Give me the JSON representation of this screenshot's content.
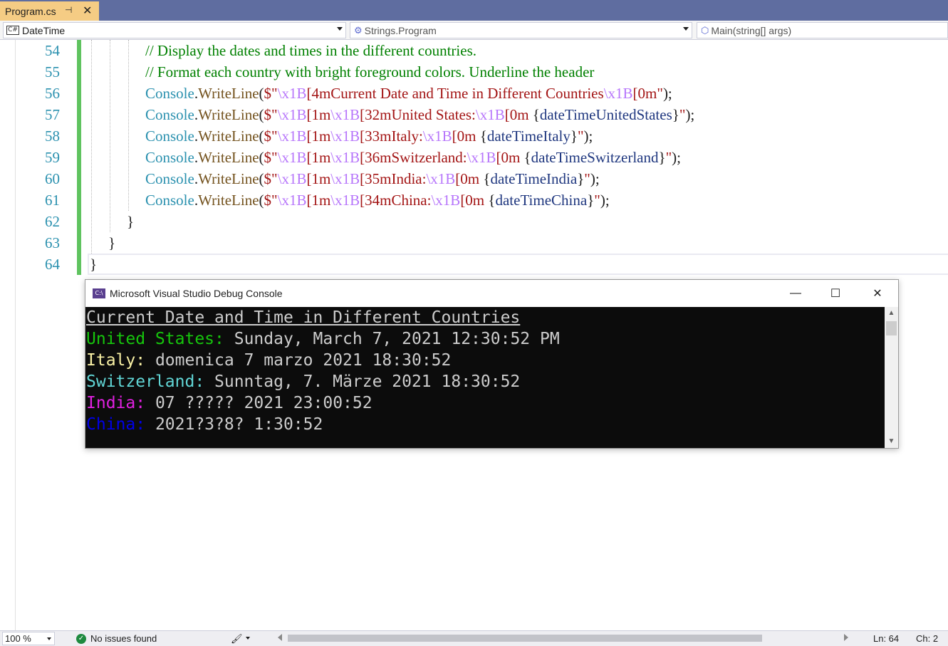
{
  "tab": {
    "title": "Program.cs",
    "pin": "⊣",
    "close": "✕"
  },
  "navbar": {
    "project_badge": "C#",
    "project": "DateTime",
    "type": "Strings.Program",
    "member": "Main(string[] args)"
  },
  "editor": {
    "line_numbers": [
      "54",
      "55",
      "56",
      "57",
      "58",
      "59",
      "60",
      "61",
      "62",
      "63",
      "64"
    ],
    "lines": [
      [
        {
          "t": "// Display the dates and times in the different countries.",
          "c": "com"
        }
      ],
      [
        {
          "t": "// Format each country with bright foreground colors. Underline the header",
          "c": "com"
        }
      ],
      [
        {
          "t": "Console",
          "c": "cls"
        },
        {
          "t": ".",
          "c": "punc"
        },
        {
          "t": "WriteLine",
          "c": "meth"
        },
        {
          "t": "(",
          "c": "punc"
        },
        {
          "t": "$\"",
          "c": "str"
        },
        {
          "t": "\\x1B",
          "c": "esc"
        },
        {
          "t": "[4mCurrent Date and Time in Different Countries",
          "c": "str"
        },
        {
          "t": "\\x1B",
          "c": "esc"
        },
        {
          "t": "[0m\"",
          "c": "str"
        },
        {
          "t": ");",
          "c": "punc"
        }
      ],
      [
        {
          "t": "Console",
          "c": "cls"
        },
        {
          "t": ".",
          "c": "punc"
        },
        {
          "t": "WriteLine",
          "c": "meth"
        },
        {
          "t": "(",
          "c": "punc"
        },
        {
          "t": "$\"",
          "c": "str"
        },
        {
          "t": "\\x1B",
          "c": "esc"
        },
        {
          "t": "[1m",
          "c": "str"
        },
        {
          "t": "\\x1B",
          "c": "esc"
        },
        {
          "t": "[32mUnited States:",
          "c": "str"
        },
        {
          "t": "\\x1B",
          "c": "esc"
        },
        {
          "t": "[0m ",
          "c": "str"
        },
        {
          "t": "{",
          "c": "punc"
        },
        {
          "t": "dateTimeUnitedStates",
          "c": "id"
        },
        {
          "t": "}",
          "c": "punc"
        },
        {
          "t": "\"",
          "c": "str"
        },
        {
          "t": ");",
          "c": "punc"
        }
      ],
      [
        {
          "t": "Console",
          "c": "cls"
        },
        {
          "t": ".",
          "c": "punc"
        },
        {
          "t": "WriteLine",
          "c": "meth"
        },
        {
          "t": "(",
          "c": "punc"
        },
        {
          "t": "$\"",
          "c": "str"
        },
        {
          "t": "\\x1B",
          "c": "esc"
        },
        {
          "t": "[1m",
          "c": "str"
        },
        {
          "t": "\\x1B",
          "c": "esc"
        },
        {
          "t": "[33mItaly:",
          "c": "str"
        },
        {
          "t": "\\x1B",
          "c": "esc"
        },
        {
          "t": "[0m ",
          "c": "str"
        },
        {
          "t": "{",
          "c": "punc"
        },
        {
          "t": "dateTimeItaly",
          "c": "id"
        },
        {
          "t": "}",
          "c": "punc"
        },
        {
          "t": "\"",
          "c": "str"
        },
        {
          "t": ");",
          "c": "punc"
        }
      ],
      [
        {
          "t": "Console",
          "c": "cls"
        },
        {
          "t": ".",
          "c": "punc"
        },
        {
          "t": "WriteLine",
          "c": "meth"
        },
        {
          "t": "(",
          "c": "punc"
        },
        {
          "t": "$\"",
          "c": "str"
        },
        {
          "t": "\\x1B",
          "c": "esc"
        },
        {
          "t": "[1m",
          "c": "str"
        },
        {
          "t": "\\x1B",
          "c": "esc"
        },
        {
          "t": "[36mSwitzerland:",
          "c": "str"
        },
        {
          "t": "\\x1B",
          "c": "esc"
        },
        {
          "t": "[0m ",
          "c": "str"
        },
        {
          "t": "{",
          "c": "punc"
        },
        {
          "t": "dateTimeSwitzerland",
          "c": "id"
        },
        {
          "t": "}",
          "c": "punc"
        },
        {
          "t": "\"",
          "c": "str"
        },
        {
          "t": ");",
          "c": "punc"
        }
      ],
      [
        {
          "t": "Console",
          "c": "cls"
        },
        {
          "t": ".",
          "c": "punc"
        },
        {
          "t": "WriteLine",
          "c": "meth"
        },
        {
          "t": "(",
          "c": "punc"
        },
        {
          "t": "$\"",
          "c": "str"
        },
        {
          "t": "\\x1B",
          "c": "esc"
        },
        {
          "t": "[1m",
          "c": "str"
        },
        {
          "t": "\\x1B",
          "c": "esc"
        },
        {
          "t": "[35mIndia:",
          "c": "str"
        },
        {
          "t": "\\x1B",
          "c": "esc"
        },
        {
          "t": "[0m ",
          "c": "str"
        },
        {
          "t": "{",
          "c": "punc"
        },
        {
          "t": "dateTimeIndia",
          "c": "id"
        },
        {
          "t": "}",
          "c": "punc"
        },
        {
          "t": "\"",
          "c": "str"
        },
        {
          "t": ");",
          "c": "punc"
        }
      ],
      [
        {
          "t": "Console",
          "c": "cls"
        },
        {
          "t": ".",
          "c": "punc"
        },
        {
          "t": "WriteLine",
          "c": "meth"
        },
        {
          "t": "(",
          "c": "punc"
        },
        {
          "t": "$\"",
          "c": "str"
        },
        {
          "t": "\\x1B",
          "c": "esc"
        },
        {
          "t": "[1m",
          "c": "str"
        },
        {
          "t": "\\x1B",
          "c": "esc"
        },
        {
          "t": "[34mChina:",
          "c": "str"
        },
        {
          "t": "\\x1B",
          "c": "esc"
        },
        {
          "t": "[0m ",
          "c": "str"
        },
        {
          "t": "{",
          "c": "punc"
        },
        {
          "t": "dateTimeChina",
          "c": "id"
        },
        {
          "t": "}",
          "c": "punc"
        },
        {
          "t": "\"",
          "c": "str"
        },
        {
          "t": ");",
          "c": "punc"
        }
      ],
      [
        {
          "t": "}",
          "c": "punc"
        }
      ],
      [
        {
          "t": "}",
          "c": "punc"
        }
      ],
      [
        {
          "t": "}",
          "c": "punc"
        }
      ]
    ]
  },
  "console": {
    "title": "Microsoft Visual Studio Debug Console",
    "icon_label": "C:\\",
    "buttons": {
      "minimize": "—",
      "maximize": "☐",
      "close": "✕"
    },
    "header": "Current Date and Time in Different Countries",
    "rows": [
      {
        "label": "United States:",
        "value": " Sunday, March 7, 2021 12:30:52 PM",
        "color": "#16c60c"
      },
      {
        "label": "Italy:",
        "value": " domenica 7 marzo 2021 18:30:52",
        "color": "#f9f1a5"
      },
      {
        "label": "Switzerland:",
        "value": " Sunntag, 7. Märze 2021 18:30:52",
        "color": "#61d6d6"
      },
      {
        "label": "India:",
        "value": " 07 ????? 2021 23:00:52",
        "color": "#e020e0"
      },
      {
        "label": "China:",
        "value": " 2021?3?8? 1:30:52",
        "color": "#0000e8"
      }
    ],
    "text_color": "#cccccc"
  },
  "statusbar": {
    "zoom": "100 %",
    "issues": "No issues found",
    "line": "Ln: 64",
    "col": "Ch: 2"
  },
  "colors": {
    "tabstrip": "#5f6da0",
    "active_tab": "#f5cc84",
    "change_bar": "#5fc35f"
  }
}
